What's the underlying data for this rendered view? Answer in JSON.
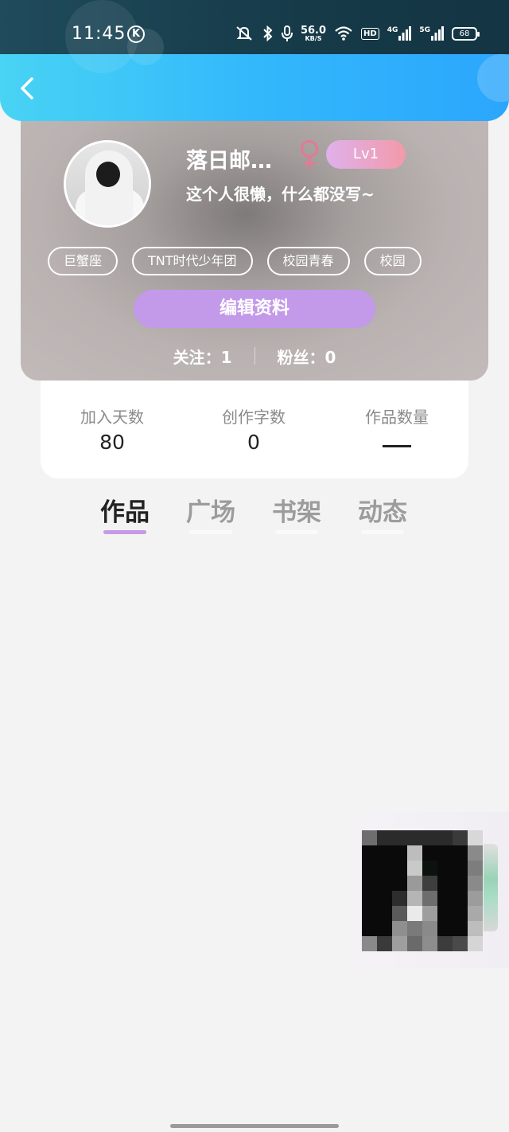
{
  "status_bar": {
    "time": "11:45",
    "k_badge": "K",
    "speed_value": "56.0",
    "speed_unit": "KB/S",
    "hd": "HD",
    "net1": "4G",
    "net2": "5G",
    "battery": "68"
  },
  "profile": {
    "username": "落日邮…",
    "gender_symbol": "♀",
    "level": "Lv1",
    "bio": "这个人很懒，什么都没写~",
    "tags": [
      "巨蟹座",
      "TNT时代少年团",
      "校园青春",
      "校园"
    ],
    "edit_button": "编辑资料",
    "following_label": "关注：",
    "following_count": "1",
    "followers_label": "粉丝：",
    "followers_count": "0"
  },
  "stats": {
    "joined_days_label": "加入天数",
    "joined_days_value": "80",
    "words_label": "创作字数",
    "words_value": "0",
    "works_label": "作品数量",
    "works_value": "--"
  },
  "tabs": [
    {
      "label": "作品",
      "active": true
    },
    {
      "label": "广场",
      "active": false
    },
    {
      "label": "书架",
      "active": false
    },
    {
      "label": "动态",
      "active": false
    }
  ],
  "colors": {
    "accent": "#c29ae9",
    "header_blue": "#33b8fb",
    "level_gradient_start": "#dfb1ec",
    "level_gradient_end": "#f29aa9",
    "female_icon": "#e07b93"
  }
}
